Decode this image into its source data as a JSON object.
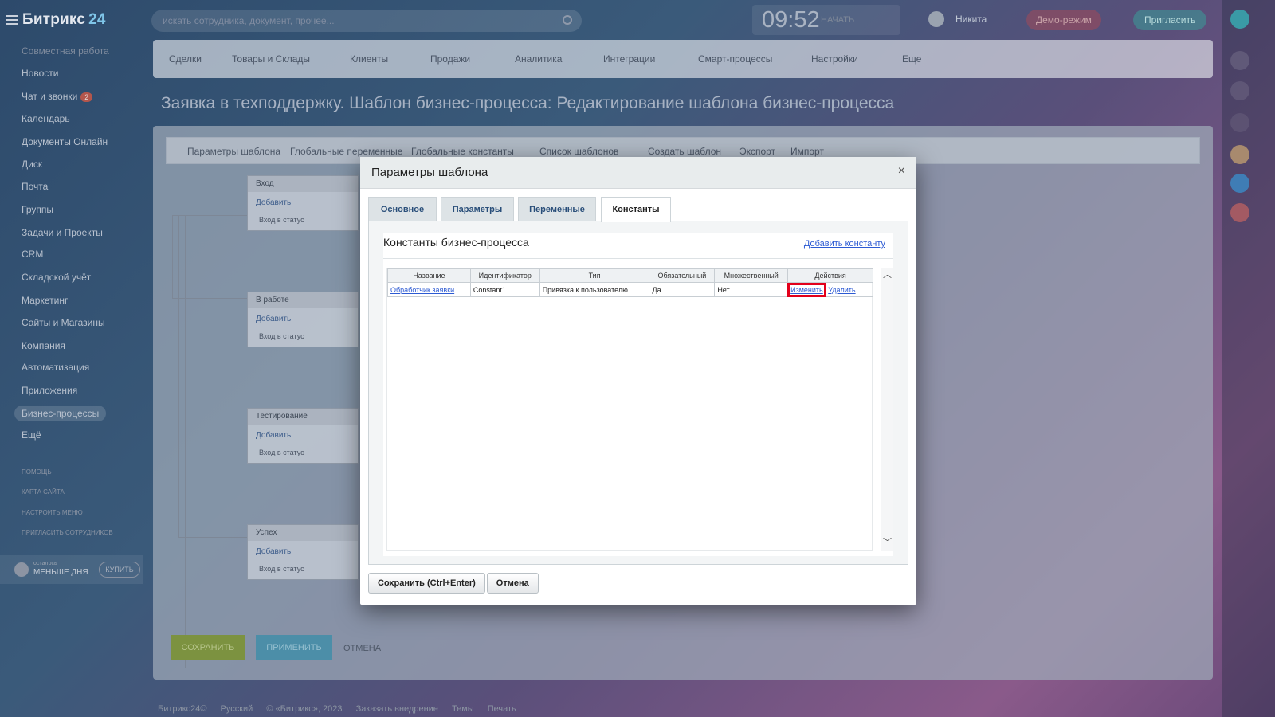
{
  "header": {
    "logo": "Битрикс",
    "logo_num": "24",
    "search_placeholder": "искать сотрудника, документ, прочее...",
    "clock": "09:52",
    "clock_start": "НАЧАТЬ",
    "user_name": "Никита",
    "demo_label": "Демо-режим",
    "invite_label": "Пригласить"
  },
  "sidebar": {
    "group_head": "Совместная работа",
    "items": [
      "Новости",
      "Чат и звонки",
      "Календарь",
      "Документы Онлайн",
      "Диск",
      "Почта",
      "Группы",
      "Задачи и Проекты",
      "CRM",
      "Складской учёт",
      "Маркетинг",
      "Сайты и Магазины",
      "Компания",
      "Автоматизация",
      "Приложения",
      "Бизнес-процессы",
      "Ещё"
    ],
    "chat_badge": "2",
    "small_links": [
      "ПОМОЩЬ",
      "КАРТА САЙТА",
      "НАСТРОИТЬ МЕНЮ",
      "ПРИГЛАСИТЬ СОТРУДНИКОВ"
    ],
    "trial_small": "осталось",
    "trial_big": "МЕНЬШЕ ДНЯ",
    "buy_label": "КУПИТЬ"
  },
  "nav": [
    "Сделки",
    "Товары и Склады",
    "Клиенты",
    "Продажи",
    "Аналитика",
    "Интеграции",
    "Смарт-процессы",
    "Настройки",
    "Еще"
  ],
  "page_title": "Заявка в техподдержку. Шаблон бизнес-процесса: Редактирование шаблона бизнес-процесса",
  "template_tabs": [
    "Параметры шаблона",
    "Глобальные переменные",
    "Глобальные константы",
    "Список шаблонов",
    "Создать шаблон",
    "Экспорт",
    "Импорт"
  ],
  "stages": [
    {
      "title": "Вход",
      "add": "Добавить",
      "entry": "Вход в статус"
    },
    {
      "title": "В работе",
      "add": "Добавить",
      "entry": "Вход в статус"
    },
    {
      "title": "Тестирование",
      "add": "Добавить",
      "entry": "Вход в статус"
    },
    {
      "title": "Успех",
      "add": "Добавить",
      "entry": "Вход в статус"
    }
  ],
  "main_buttons": {
    "save": "СОХРАНИТЬ",
    "apply": "ПРИМЕНИТЬ",
    "cancel": "ОТМЕНА"
  },
  "footer": [
    "Битрикс24©",
    "Русский",
    "© «Битрикс», 2023",
    "Заказать внедрение",
    "Темы",
    "Печать"
  ],
  "modal": {
    "title": "Параметры шаблона",
    "close": "×",
    "tabs": [
      "Основное",
      "Параметры",
      "Переменные",
      "Константы"
    ],
    "active_tab": "Константы",
    "section_title": "Константы бизнес-процесса",
    "add_link": "Добавить константу",
    "columns": [
      "Название",
      "Идентификатор",
      "Тип",
      "Обязательный",
      "Множественный",
      "Действия"
    ],
    "rows": [
      {
        "name": "Обработчик заявки",
        "id": "Constant1",
        "type": "Привязка к пользователю",
        "required": "Да",
        "multiple": "Нет",
        "edit": "Изменить",
        "delete": "Удалить"
      }
    ],
    "save_button": "Сохранить (Ctrl+Enter)",
    "cancel_button": "Отмена"
  },
  "colors": {
    "highlight": "#e3001b",
    "link": "#2c5ad3"
  }
}
